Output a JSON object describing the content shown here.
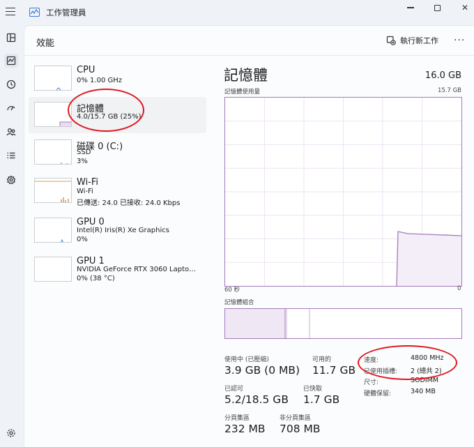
{
  "app": {
    "title": "工作管理員"
  },
  "window": {
    "min_icon": "minimize-icon",
    "max_icon": "maximize-icon",
    "close_glyph": "✕"
  },
  "nav": {
    "items": [
      {
        "icon": "processes-icon"
      },
      {
        "icon": "performance-icon",
        "active": true
      },
      {
        "icon": "app-history-icon"
      },
      {
        "icon": "startup-apps-icon"
      },
      {
        "icon": "users-icon"
      },
      {
        "icon": "details-icon"
      },
      {
        "icon": "services-icon"
      }
    ],
    "settings_icon": "settings-icon"
  },
  "header": {
    "title": "效能",
    "run_task_label": "執行新工作",
    "more_glyph": "···"
  },
  "devices": [
    {
      "name": "CPU",
      "sub1": "0% 1.00 GHz",
      "sub2": ""
    },
    {
      "name": "記憶體",
      "sub1": "4.0/15.7 GB (25%)",
      "sub2": ""
    },
    {
      "name": "磁碟 0 (C:)",
      "sub1": "SSD",
      "sub2": "3%"
    },
    {
      "name": "Wi-Fi",
      "sub1": "Wi-Fi",
      "sub2": "已傳送: 24.0 已接收: 24.0 Kbps"
    },
    {
      "name": "GPU 0",
      "sub1": "Intel(R) Iris(R) Xe Graphics",
      "sub2": "0%"
    },
    {
      "name": "GPU 1",
      "sub1": "NVIDIA GeForce RTX 3060 Lapto…",
      "sub2": "0% (38 °C)"
    }
  ],
  "detail": {
    "title": "記憶體",
    "total": "16.0 GB",
    "usage_label": "記憶體使用量",
    "usage_max": "15.7 GB",
    "axis_left": "60 秒",
    "axis_right": "0",
    "composition_label": "記憶體組合",
    "stats": {
      "in_use_label": "使用中 (已壓縮)",
      "in_use_value": "3.9 GB (0 MB)",
      "available_label": "可用的",
      "available_value": "11.7 GB",
      "committed_label": "已認可",
      "committed_value": "5.2/18.5 GB",
      "cached_label": "已快取",
      "cached_value": "1.7 GB",
      "paged_label": "分頁集區",
      "paged_value": "232 MB",
      "nonpaged_label": "非分頁集區",
      "nonpaged_value": "708 MB"
    },
    "props": [
      {
        "key": "速度:",
        "value": "4800 MHz"
      },
      {
        "key": "已使用插槽:",
        "value": "2 (總共 2)"
      },
      {
        "key": "尺寸:",
        "value": "SODIMM"
      },
      {
        "key": "硬體保留:",
        "value": "340 MB"
      }
    ]
  },
  "colors": {
    "memory": "#a37ab9",
    "annotation": "#e0151c",
    "cpu": "#3b8fd9",
    "disk": "#4caf50",
    "wifi": "#c97b2a"
  }
}
